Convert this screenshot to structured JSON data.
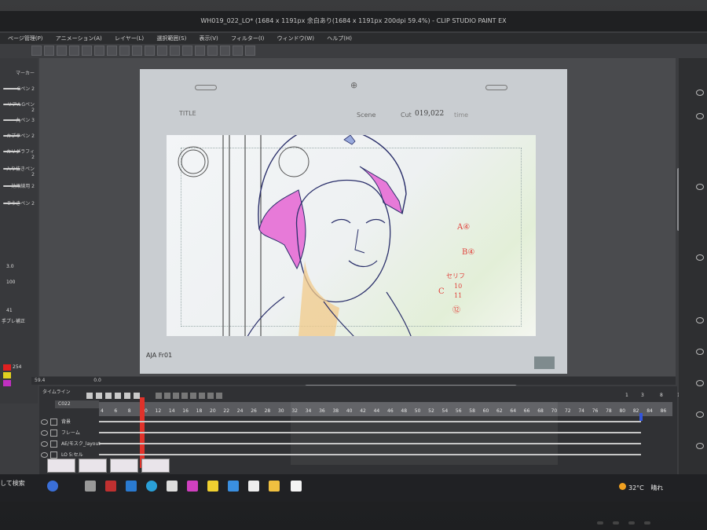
{
  "window": {
    "title": "WH019_022_LO* (1684 x 1191px 余白あり(1684 x 1191px 200dpi 59.4%) - CLIP STUDIO PAINT EX"
  },
  "menu": [
    "ページ管理(P)",
    "アニメーション(A)",
    "レイヤー(L)",
    "選択範囲(S)",
    "表示(V)",
    "フィルター(I)",
    "ウィンドウ(W)",
    "ヘルプ(H)"
  ],
  "brushes": [
    "マーカー",
    "Gペン 2",
    "リアルGペン 2",
    "丸ペン 3",
    "カブラペン 2",
    "カリグラフィ 2",
    "入り抜きペン 2",
    "効果線用 2",
    "ぞうきペン 2"
  ],
  "left_values": {
    "size": "3.0",
    "opacity": "100",
    "stabilize": "41",
    "stabilize_label": "手ブレ補正",
    "num1": "254"
  },
  "paper": {
    "title_label": "TITLE",
    "scene_label": "Scene",
    "cut_label": "Cut",
    "cut_value": "019,022",
    "time_label": "time",
    "footer": "AJA Fr01"
  },
  "annotations": [
    "A④",
    "B④",
    "セリフ",
    "C",
    "10",
    "11",
    "⑫"
  ],
  "status": {
    "zoom": "59.4",
    "frame": "0.0"
  },
  "timeline": {
    "tab": "タイムライン",
    "name": "C022",
    "ruler_numbers": [
      "4",
      "6",
      "8",
      "10",
      "12",
      "14",
      "16",
      "18",
      "20",
      "22",
      "24",
      "26",
      "28",
      "30",
      "32",
      "34",
      "36",
      "38",
      "40",
      "42",
      "44",
      "46",
      "48",
      "50",
      "52",
      "54",
      "56",
      "58",
      "60",
      "62",
      "64",
      "66",
      "68",
      "70",
      "72",
      "74",
      "76",
      "78",
      "80",
      "82",
      "84",
      "86"
    ],
    "top_markers": [
      "1",
      "3",
      "8",
      "1",
      "84"
    ],
    "tracks": [
      "背景",
      "フレーム",
      "AE/モスク_layout",
      "LO  5:セル"
    ]
  },
  "taskbar": {
    "search": "して検索",
    "temperature": "32°C",
    "weather": "晴れ"
  }
}
